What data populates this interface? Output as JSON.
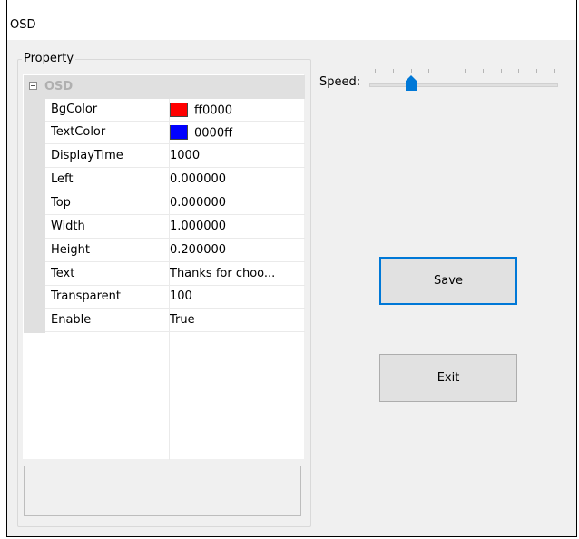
{
  "window": {
    "title": "OSD"
  },
  "property_group": {
    "label": "Property",
    "category": "OSD",
    "rows": [
      {
        "name": "BgColor",
        "value": "ff0000",
        "swatch": "#ff0000"
      },
      {
        "name": "TextColor",
        "value": "0000ff",
        "swatch": "#0000ff"
      },
      {
        "name": "DisplayTime",
        "value": "1000"
      },
      {
        "name": "Left",
        "value": "0.000000"
      },
      {
        "name": "Top",
        "value": "0.000000"
      },
      {
        "name": "Width",
        "value": "1.000000"
      },
      {
        "name": "Height",
        "value": "0.200000"
      },
      {
        "name": "Text",
        "value": "Thanks for choo..."
      },
      {
        "name": "Transparent",
        "value": "100"
      },
      {
        "name": "Enable",
        "value": "True"
      }
    ]
  },
  "speed": {
    "label": "Speed:",
    "value": 2,
    "min": 0,
    "max": 10
  },
  "buttons": {
    "save": "Save",
    "exit": "Exit"
  },
  "colors": {
    "accent": "#0078d7",
    "thumb": "#0078d7"
  }
}
